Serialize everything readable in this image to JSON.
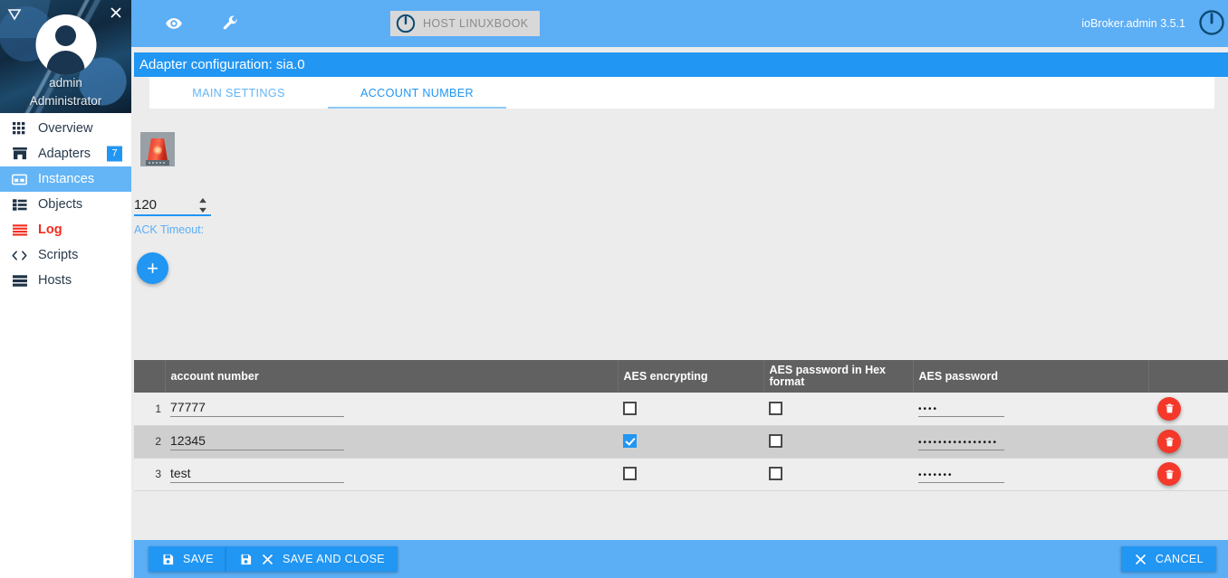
{
  "sidebar": {
    "profile": {
      "name": "admin",
      "role": "Administrator",
      "collapse_icon": "triangle-down-icon",
      "close_icon": "close-icon",
      "avatar_icon": "avatar"
    },
    "items": [
      {
        "label": "Overview",
        "icon": "grid-icon",
        "selected": false,
        "alert": false,
        "badge": ""
      },
      {
        "label": "Adapters",
        "icon": "store-icon",
        "selected": false,
        "alert": false,
        "badge": "7"
      },
      {
        "label": "Instances",
        "icon": "card-icon",
        "selected": true,
        "alert": false,
        "badge": ""
      },
      {
        "label": "Objects",
        "icon": "list-icon",
        "selected": false,
        "alert": false,
        "badge": ""
      },
      {
        "label": "Log",
        "icon": "lines-icon",
        "selected": false,
        "alert": true,
        "badge": ""
      },
      {
        "label": "Scripts",
        "icon": "code-icon",
        "selected": false,
        "alert": false,
        "badge": ""
      },
      {
        "label": "Hosts",
        "icon": "server-icon",
        "selected": false,
        "alert": false,
        "badge": ""
      }
    ]
  },
  "topbar": {
    "eye_icon": "eye-icon",
    "wrench_icon": "wrench-icon",
    "host_button_label": "HOST LINUXBOOK",
    "host_power_icon": "power-icon",
    "version": "ioBroker.admin 3.5.1",
    "power_icon": "power-icon"
  },
  "config": {
    "title": "Adapter configuration: sia.0",
    "tabs": [
      {
        "label": "MAIN SETTINGS",
        "active": false
      },
      {
        "label": "ACCOUNT NUMBER",
        "active": true
      }
    ],
    "adapter_icon": "siren-icon",
    "timeout": {
      "value": "120",
      "label": "ACK Timeout:",
      "spinner_icon": "spinner-updown-icon"
    },
    "add_button_label": "+"
  },
  "table": {
    "columns": [
      "",
      "account number",
      "AES encrypting",
      "AES password in Hex format",
      "AES password",
      ""
    ],
    "rows": [
      {
        "num": "1",
        "account": "77777",
        "aes_encrypting": false,
        "aes_hex": false,
        "password": "••••",
        "delete_icon": "trash-icon"
      },
      {
        "num": "2",
        "account": "12345",
        "aes_encrypting": true,
        "aes_hex": false,
        "password": "••••••••••••••••",
        "delete_icon": "trash-icon"
      },
      {
        "num": "3",
        "account": "test",
        "aes_encrypting": false,
        "aes_hex": false,
        "password": "•••••••",
        "delete_icon": "trash-icon"
      }
    ]
  },
  "actions": {
    "save": "SAVE",
    "save_and_close": "SAVE AND CLOSE",
    "cancel": "CANCEL",
    "save_icon": "floppy-icon",
    "close_icon": "close-icon"
  },
  "colors": {
    "topbar": "#5caef5",
    "title": "#2196f3",
    "selected": "#64b5f6",
    "alert": "#f32c1e",
    "table_header": "#616161",
    "delete": "#f4382a"
  }
}
